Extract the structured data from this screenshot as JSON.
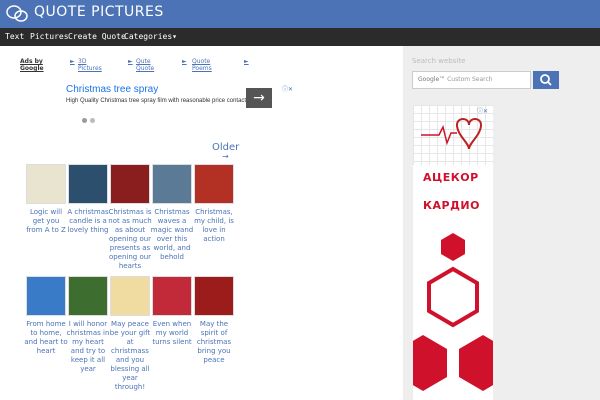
{
  "header": {
    "title": "QUOTE PICTURES",
    "logo_icon": "speech-bubbles-icon"
  },
  "nav": {
    "items": [
      {
        "label": "Text"
      },
      {
        "label": "Pictures"
      },
      {
        "label": "Create Quote"
      },
      {
        "label": "Categories▾"
      }
    ]
  },
  "ads": {
    "ads_by": "Ads by Google",
    "links": [
      "3D Pictures",
      "Qute Quote",
      "Quote Poems"
    ],
    "title": "Christmas tree spray",
    "desc": "High Quality Christmas tree spray film with reasonable price contact"
  },
  "older": "Older",
  "thumbs": [
    {
      "caption": "Logic will get you from A to Z",
      "color": "#e9e4cf"
    },
    {
      "caption": "A christmas candle is a lovely thing",
      "color": "#2c4f6e"
    },
    {
      "caption": "Christmas is not as much as about opening our presents as opening our hearts",
      "color": "#8a1e1e"
    },
    {
      "caption": "Christmas waves a magic wand over this world, and behold",
      "color": "#5a7a96"
    },
    {
      "caption": "Christmas, my child, is love in action",
      "color": "#b33025"
    },
    {
      "caption": "From home to home, and heart to heart",
      "color": "#3a7bc8"
    },
    {
      "caption": "I will honor christmas in my heart and try to keep it all year",
      "color": "#3d6e2f"
    },
    {
      "caption": "May peace be your gift at christmass and you blessing all year through!",
      "color": "#f0dca0"
    },
    {
      "caption": "Even when my world turns silent",
      "color": "#c22a3a"
    },
    {
      "caption": "May the spirit of christmas bring you peace",
      "color": "#9c1c1c"
    }
  ],
  "sidebar": {
    "search_label": "Search website",
    "search_placeholder": "Custom Search",
    "google": "Google™",
    "banner_line1": "АЦЕКОР",
    "banner_line2": "КАРДИО"
  }
}
